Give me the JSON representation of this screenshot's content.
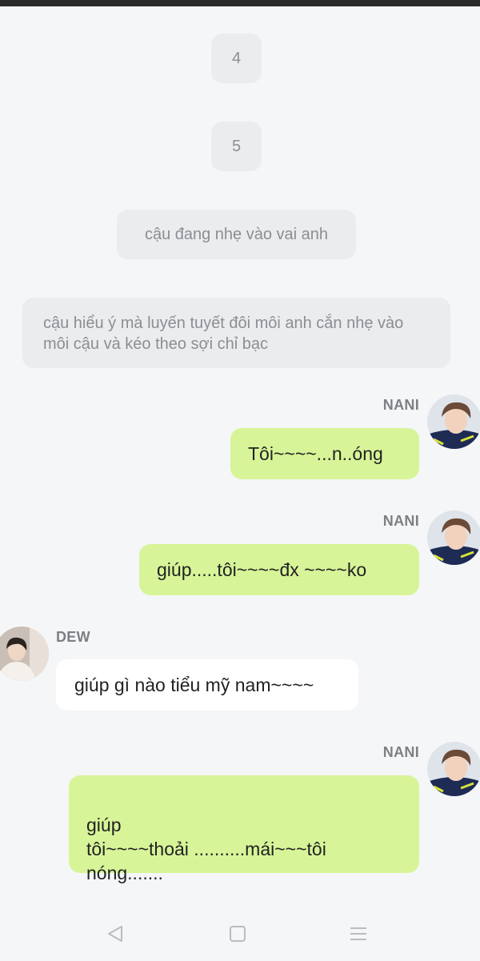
{
  "narration": [
    {
      "text": "4"
    },
    {
      "text": "5"
    },
    {
      "text": "cậu đang nhẹ vào vai anh"
    },
    {
      "text": "cậu hiểu ý mà luyến tuyết đôi môi anh cắn nhẹ vào môi cậu và kéo theo sợi chỉ bạc"
    }
  ],
  "messages": [
    {
      "sender": "NANI",
      "text": "Tôi~~~~...n..óng",
      "side": "right"
    },
    {
      "sender": "NANI",
      "text": "giúp.....tôi~~~~đx ~~~~ko",
      "side": "right"
    },
    {
      "sender": "DEW",
      "text": "giúp gì nào tiểu mỹ nam~~~~",
      "side": "left"
    },
    {
      "sender": "NANI",
      "text": "giúp\ntôi~~~~thoải ..........mái~~~tôi\nnóng.......",
      "side": "right"
    }
  ],
  "nav": {
    "back_icon": "back-triangle-icon",
    "home_icon": "home-square-icon",
    "menu_icon": "menu-lines-icon"
  },
  "colors": {
    "background": "#f5f6f8",
    "narration_bg": "#ebecee",
    "my_bubble": "#d7f598",
    "their_bubble": "#ffffff",
    "status_bar": "#2b2b2b"
  }
}
